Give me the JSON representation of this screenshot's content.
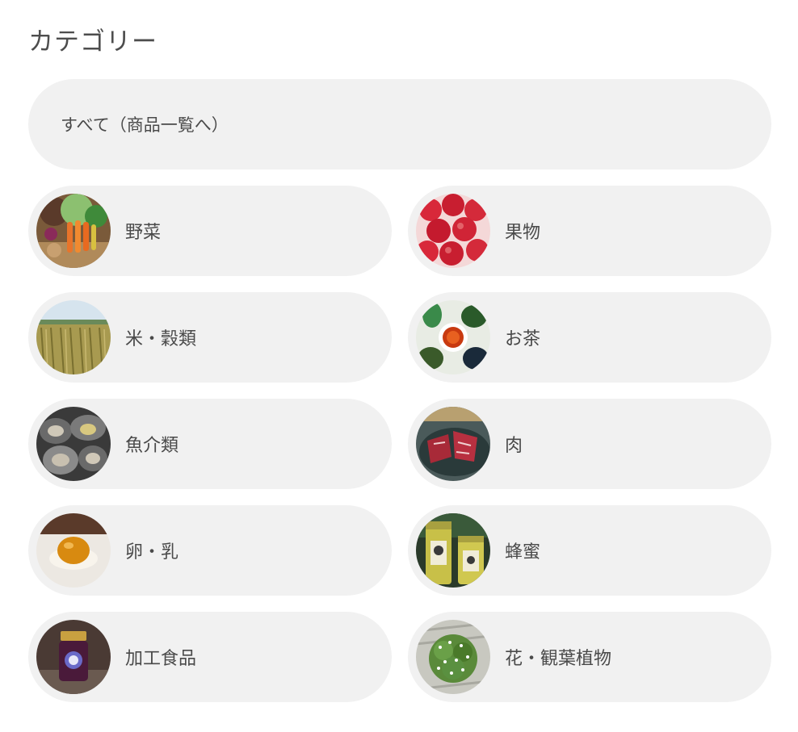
{
  "page": {
    "title": "カテゴリー"
  },
  "all_link": {
    "label": "すべて（商品一覧へ）"
  },
  "categories": [
    {
      "label": "野菜",
      "icon": "vegetables-icon"
    },
    {
      "label": "果物",
      "icon": "apples-icon"
    },
    {
      "label": "米・穀類",
      "icon": "rice-field-icon"
    },
    {
      "label": "お茶",
      "icon": "tea-icon"
    },
    {
      "label": "魚介類",
      "icon": "oysters-icon"
    },
    {
      "label": "肉",
      "icon": "meat-icon"
    },
    {
      "label": "卵・乳",
      "icon": "egg-yolk-icon"
    },
    {
      "label": "蜂蜜",
      "icon": "honey-jars-icon"
    },
    {
      "label": "加工食品",
      "icon": "jam-jar-icon"
    },
    {
      "label": "花・観葉植物",
      "icon": "plant-pot-icon"
    }
  ],
  "colors": {
    "pill_background": "#f1f1f1",
    "text": "#4a4a4a"
  }
}
